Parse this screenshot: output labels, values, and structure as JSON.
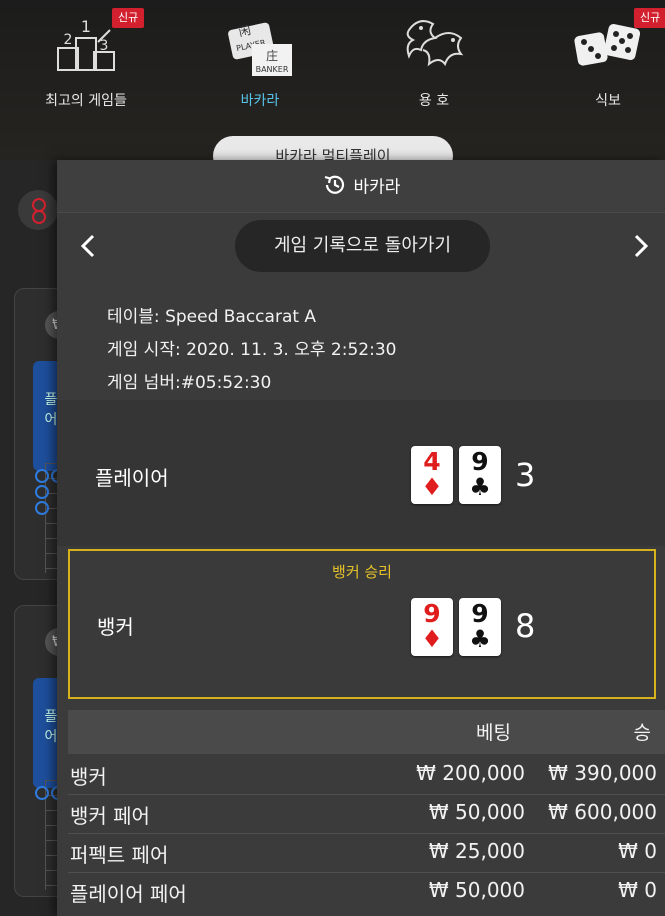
{
  "nav": {
    "items": [
      {
        "label": "최고의 게임들",
        "badge": "신규",
        "icon": "podium-icon"
      },
      {
        "label": "바카라",
        "icon": "baccarat-icon",
        "active": true
      },
      {
        "label": "용 호",
        "icon": "dragon-tiger-icon"
      },
      {
        "label": "식보",
        "badge": "신규",
        "icon": "dice-icon"
      }
    ],
    "podium_digits": [
      "1",
      "2",
      "3"
    ],
    "baccarat_icon_text": [
      "闲",
      "PLAYER",
      "庄",
      "BANKER"
    ],
    "multi_play_label": "바카라 멀티플레이"
  },
  "panel": {
    "title": "바카라",
    "back_label": "게임 기록으로 돌아가기",
    "table_label": "테이블:",
    "table_value": "Speed Baccarat A",
    "start_label": "게임 시작:",
    "start_value": "2020. 11. 3. 오후 2:52:30",
    "number_label": "게임 넘버:",
    "number_value": "#05:52:30"
  },
  "hands": {
    "player": {
      "label": "플레이어",
      "score": "3",
      "cards": [
        {
          "rank": "4",
          "suit": "♦",
          "color": "red"
        },
        {
          "rank": "9",
          "suit": "♣",
          "color": "black"
        }
      ]
    },
    "banker": {
      "label": "뱅커",
      "score": "8",
      "result": "뱅커 승리",
      "cards": [
        {
          "rank": "9",
          "suit": "♦",
          "color": "red"
        },
        {
          "rank": "9",
          "suit": "♣",
          "color": "black"
        }
      ]
    }
  },
  "bets": {
    "headers": {
      "bet": "베팅",
      "win": "승"
    },
    "rows": [
      {
        "name": "뱅커",
        "bet": "₩ 200,000",
        "win": "₩ 390,000"
      },
      {
        "name": "뱅커 페어",
        "bet": "₩ 50,000",
        "win": "₩ 600,000"
      },
      {
        "name": "퍼펙트 페어",
        "bet": "₩ 25,000",
        "win": "₩ 0"
      },
      {
        "name": "플레이어 페어",
        "bet": "₩ 50,000",
        "win": "₩ 0"
      }
    ]
  },
  "lobby": {
    "coin": "₩",
    "player_short": "플\n어"
  },
  "colors": {
    "accent": "#58c3e8",
    "badge": "#d3202f",
    "win_border": "#d6b21c",
    "panel": "#3b3b3b"
  }
}
